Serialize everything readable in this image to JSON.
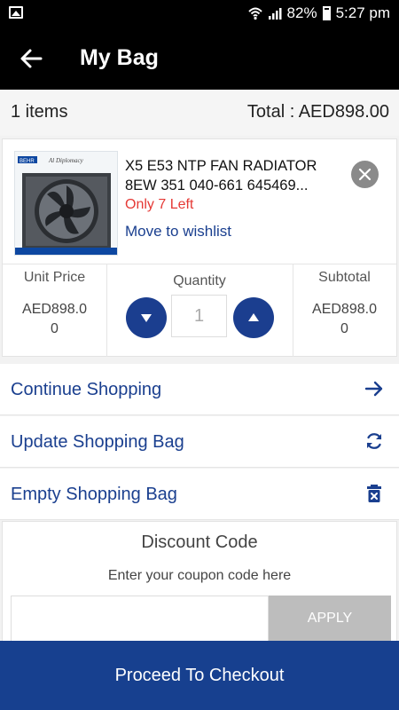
{
  "status_bar": {
    "battery": "82%",
    "time": "5:27 pm"
  },
  "app_bar": {
    "title": "My Bag"
  },
  "summary": {
    "items": "1 items",
    "total": "Total : AED898.00"
  },
  "cart_item": {
    "thumb_brand": "BEHR",
    "thumb_caption": "Al Diplomacy",
    "name": "X5 E53 NTP FAN RADIATOR 8EW 351 040-661 645469...",
    "stock": "Only 7 Left",
    "wishlist_label": "Move to wishlist",
    "unit_price_label": "Unit Price",
    "unit_price_line1": "AED898.0",
    "unit_price_line2": "0",
    "quantity_label": "Quantity",
    "quantity": "1",
    "subtotal_label": "Subtotal",
    "subtotal_line1": "AED898.0",
    "subtotal_line2": "0"
  },
  "actions": {
    "continue": "Continue Shopping",
    "update": "Update Shopping Bag",
    "empty": "Empty Shopping Bag"
  },
  "discount": {
    "title": "Discount Code",
    "hint": "Enter your coupon code here",
    "apply_label": "APPLY"
  },
  "checkout_label": "Proceed To Checkout",
  "colors": {
    "primary": "#17408f",
    "accent_red": "#e53935",
    "app_bar": "#000000"
  }
}
